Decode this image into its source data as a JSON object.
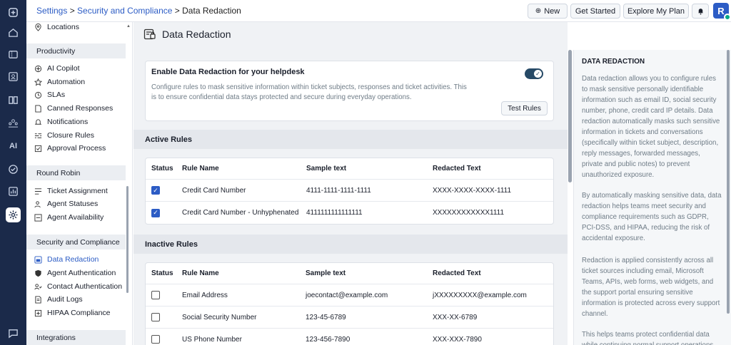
{
  "rail": {
    "icons": [
      "home-icon",
      "ticket-icon",
      "contacts-icon",
      "knowledge-icon",
      "groups-icon",
      "ai-icon",
      "tasks-icon",
      "reports-icon",
      "settings-icon",
      "chat-icon"
    ],
    "ai_label": "AI"
  },
  "header": {
    "breadcrumb_settings": "Settings",
    "breadcrumb_sep1": " > ",
    "breadcrumb_security": "Security and Compliance",
    "breadcrumb_sep2": " > ",
    "breadcrumb_current": "Data Redaction",
    "new_label": "New",
    "get_started_label": "Get Started",
    "explore_label": "Explore My Plan",
    "avatar_letter": "R"
  },
  "sidebar": {
    "top_item": "Locations",
    "productivity_head": "Productivity",
    "productivity": [
      "AI Copilot",
      "Automation",
      "SLAs",
      "Canned Responses",
      "Notifications",
      "Closure Rules",
      "Approval Process"
    ],
    "round_robin_head": "Round Robin",
    "round_robin": [
      "Ticket Assignment",
      "Agent Statuses",
      "Agent Availability"
    ],
    "security_head": "Security and Compliance",
    "security": [
      "Data Redaction",
      "Agent Authentication",
      "Contact Authentication",
      "Audit Logs",
      "HIPAA Compliance"
    ],
    "integrations_head": "Integrations"
  },
  "main": {
    "page_title": "Data Redaction",
    "card_title": "Enable Data Redaction for your helpdesk",
    "card_desc": "Configure rules to mask sensitive information within ticket subjects, responses and ticket activities. This is to ensure confidential data stays protected and secure during everyday operations.",
    "toggle_on": true,
    "test_rules_label": "Test Rules",
    "active_head": "Active Rules",
    "inactive_head": "Inactive Rules",
    "columns": [
      "Status",
      "Rule Name",
      "Sample text",
      "Redacted Text"
    ],
    "active_rules": [
      {
        "checked": true,
        "name": "Credit Card Number",
        "sample": "4111-1111-1111-1111",
        "redacted": "XXXX-XXXX-XXXX-1111"
      },
      {
        "checked": true,
        "name": "Credit Card Number - Unhyphenated",
        "sample": "4111111111111111",
        "redacted": "XXXXXXXXXXXX1111"
      }
    ],
    "inactive_rules": [
      {
        "checked": false,
        "name": "Email Address",
        "sample": "joecontact@example.com",
        "redacted": "jXXXXXXXXX@example.com"
      },
      {
        "checked": false,
        "name": "Social Security Number",
        "sample": "123-45-6789",
        "redacted": "XXX-XX-6789"
      },
      {
        "checked": false,
        "name": "US Phone Number",
        "sample": "123-456-7890",
        "redacted": "XXX-XXX-7890"
      }
    ]
  },
  "help": {
    "title": "DATA REDACTION",
    "p1": "Data redaction allows you to configure rules to mask sensitive personally identifiable information such as email ID, social security number, phone, credit card IP details. Data redaction automatically masks such sensitive information in tickets and conversations (specifically within ticket subject, description, reply messages, forwarded messages, private and public notes) to prevent unauthorized exposure.",
    "p2": "By automatically masking sensitive data, data redaction helps teams meet security and compliance requirements such as GDPR, PCI-DSS, and HIPAA, reducing the risk of accidental exposure.",
    "p3": "Redaction is applied consistently across all ticket sources including email, Microsoft Teams, APIs, web forms, web widgets, and the support portal ensuring sensitive information is protected across every support channel.",
    "p4": "This helps teams protect confidential data while continuing normal support operations."
  },
  "colors": {
    "rail": "#1b2a4a",
    "accent": "#2c5cc5",
    "toggle": "#264966"
  }
}
